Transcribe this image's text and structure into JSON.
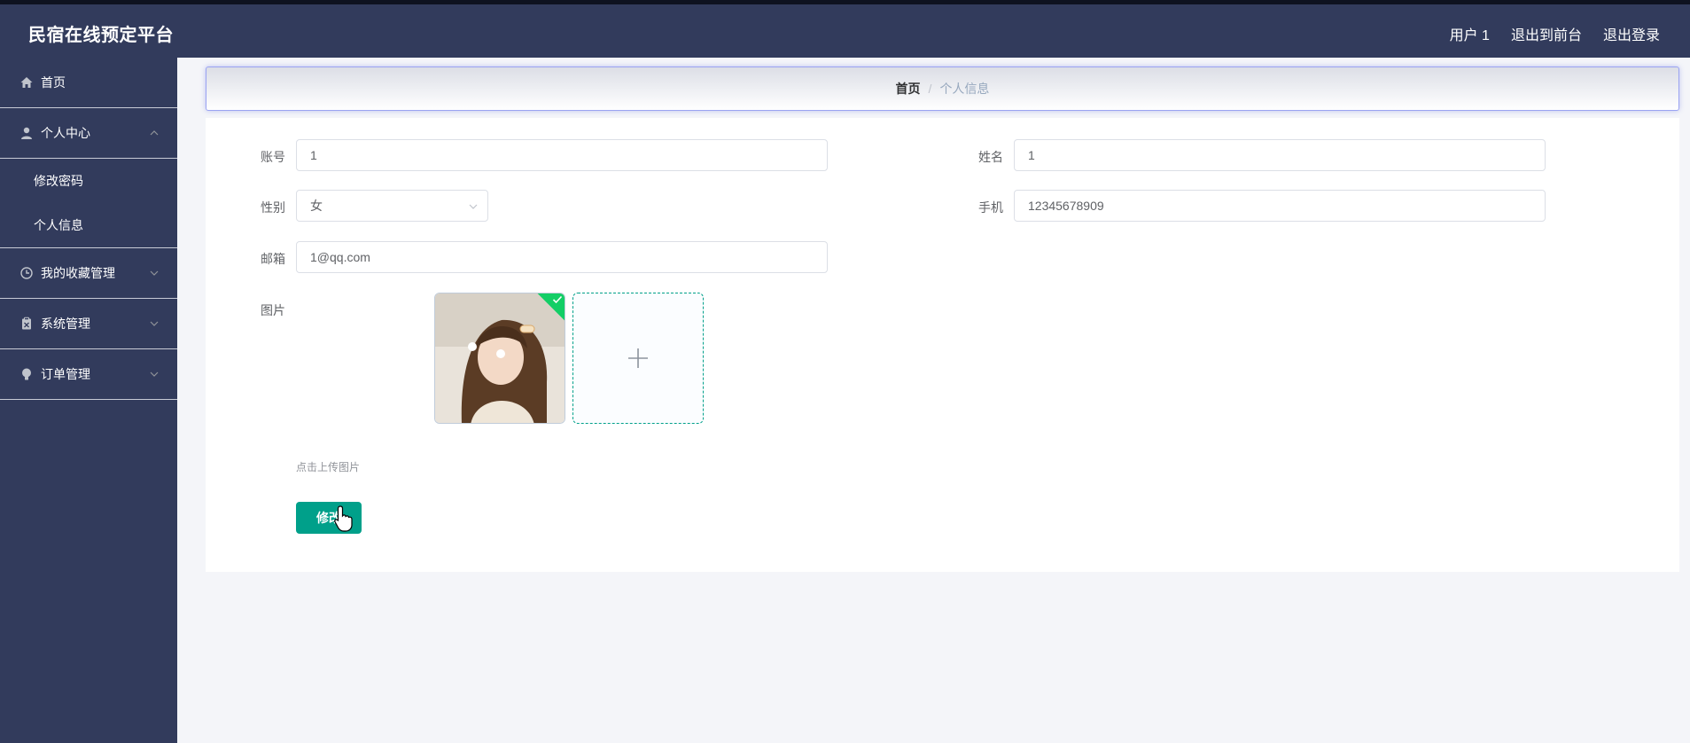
{
  "app": {
    "title": "民宿在线预定平台"
  },
  "header": {
    "links": [
      {
        "label": "用户 1",
        "icon": "user-name"
      },
      {
        "label": "退出到前台",
        "icon": "exit-front"
      },
      {
        "label": "退出登录",
        "icon": "logout"
      }
    ]
  },
  "sidebar": {
    "items": [
      {
        "label": "首页",
        "icon": "home-icon"
      },
      {
        "label": "个人中心",
        "icon": "person-icon",
        "expanded": true,
        "children": [
          {
            "label": "修改密码"
          },
          {
            "label": "个人信息"
          }
        ]
      },
      {
        "label": "我的收藏管理",
        "icon": "clock-icon"
      },
      {
        "label": "系统管理",
        "icon": "clipboard-icon"
      },
      {
        "label": "订单管理",
        "icon": "lightbulb-icon"
      }
    ]
  },
  "breadcrumb": {
    "home": "首页",
    "separator": "/",
    "current": "个人信息"
  },
  "form": {
    "account": {
      "label": "账号",
      "value": "1"
    },
    "name": {
      "label": "姓名",
      "value": "1"
    },
    "gender": {
      "label": "性别",
      "value": "女"
    },
    "phone": {
      "label": "手机",
      "value": "12345678909"
    },
    "email": {
      "label": "邮箱",
      "value": "1@qq.com"
    },
    "image": {
      "label": "图片",
      "hint": "点击上传图片"
    },
    "submit_label": "修改"
  },
  "colors": {
    "sidebar_bg": "#323b5c",
    "accent": "#00a08a",
    "success_badge": "#13ce66",
    "breadcrumb_border": "#9aa3f2"
  }
}
